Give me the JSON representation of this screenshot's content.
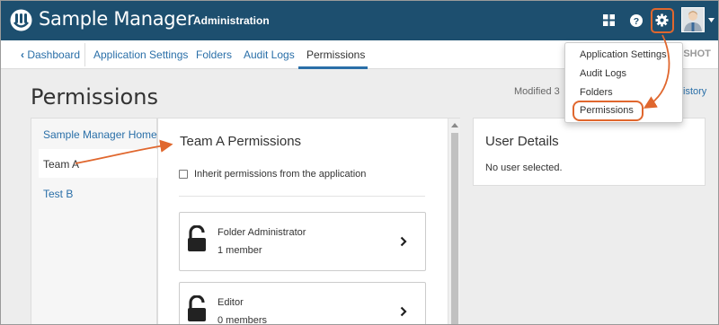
{
  "header": {
    "app_title": "Sample Manager",
    "section": "Administration",
    "icons": [
      "sample-manager-logo-icon",
      "grid-icon",
      "help-icon",
      "gear-icon",
      "user-avatar-icon",
      "caret-down-icon"
    ]
  },
  "subnav": {
    "items": [
      {
        "label": "Dashboard",
        "icon": "chevron-left-icon"
      },
      {
        "label": "Application Settings"
      },
      {
        "label": "Folders"
      },
      {
        "label": "Audit Logs"
      },
      {
        "label": "Permissions",
        "active": true
      }
    ],
    "overflow_fragment": "PSHOT"
  },
  "page": {
    "title": "Permissions",
    "modified": "Modified 3",
    "history_link": "istory"
  },
  "folders": {
    "items": [
      {
        "label": "Sample Manager Home"
      },
      {
        "label": "Team A",
        "selected": true
      },
      {
        "label": "Test B"
      }
    ]
  },
  "team": {
    "title": "Team A Permissions",
    "inherit_label": "Inherit permissions from the application",
    "inherit_checked": false,
    "roles": [
      {
        "name": "Folder Administrator",
        "members": "1 member",
        "icon": "lock-open-icon"
      },
      {
        "name": "Editor",
        "members": "0 members",
        "icon": "lock-open-icon"
      }
    ]
  },
  "user_details": {
    "title": "User Details",
    "empty_text": "No user selected."
  },
  "settings_menu": {
    "items": [
      {
        "label": "Application Settings"
      },
      {
        "label": "Audit Logs"
      },
      {
        "label": "Folders"
      },
      {
        "label": "Permissions",
        "highlighted": true
      }
    ]
  },
  "colors": {
    "header_bg": "#1d4f6f",
    "link": "#2a6fa8",
    "annotation": "#e0672e",
    "page_bg": "#ededed"
  }
}
